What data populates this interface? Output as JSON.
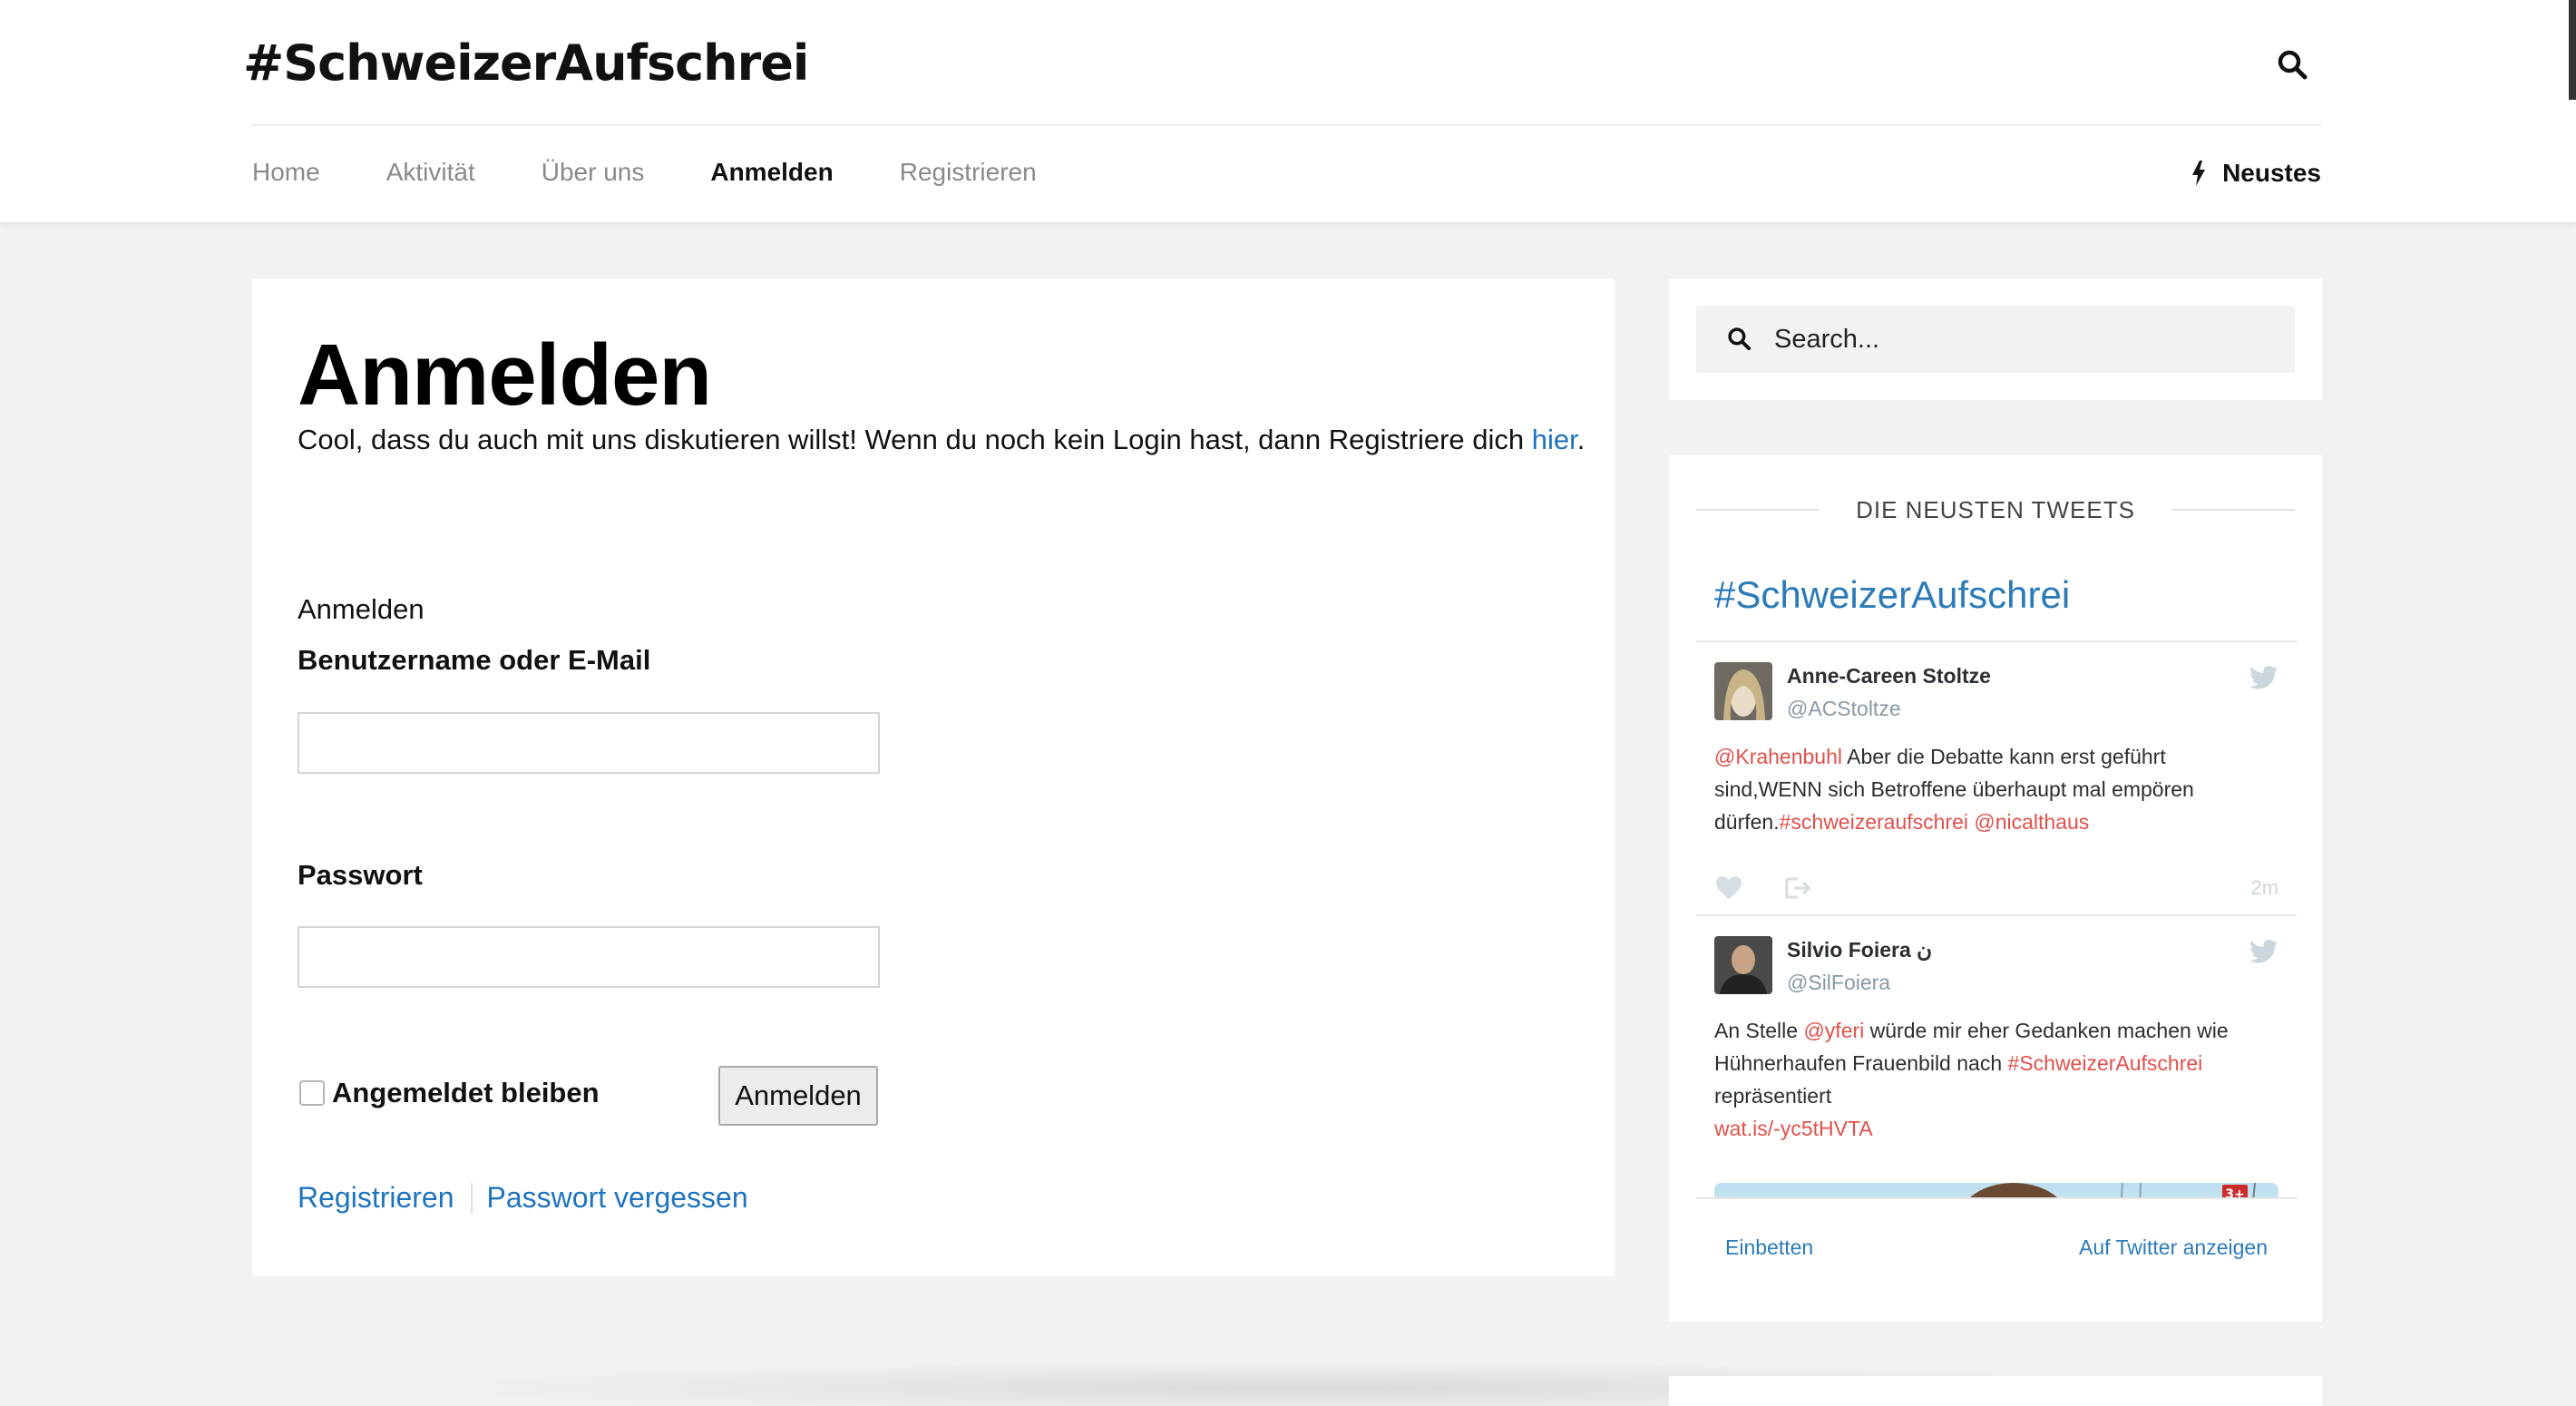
{
  "header": {
    "site_title": "#SchweizerAufschrei",
    "nav": [
      "Home",
      "Aktivität",
      "Über uns",
      "Anmelden",
      "Registrieren"
    ],
    "active_nav": "Anmelden",
    "neustes_label": "Neustes"
  },
  "main": {
    "title": "Anmelden",
    "intro_text": "Cool, dass du auch mit uns diskutieren willst! Wenn du noch kein Login hast, dann Registriere dich ",
    "intro_link": "hier",
    "intro_end": ".",
    "form_legend": "Anmelden",
    "username_label": "Benutzername oder E-Mail",
    "username_value": "",
    "password_label": "Passwort",
    "password_value": "",
    "remember_label": "Angemeldet bleiben",
    "remember_checked": false,
    "submit_label": "Anmelden",
    "register_link": "Registrieren",
    "forgot_link": "Passwort vergessen"
  },
  "sidebar": {
    "search_placeholder": "Search...",
    "widget_title": "DIE NEUSTEN TWEETS",
    "embed_title": "#SchweizerAufschrei",
    "tweets": [
      {
        "name": "Anne-Careen Stoltze",
        "handle": "@ACStoltze",
        "mention": "@Krahenbuhl",
        "text_1": " Aber die Debatte kann erst geführt sind,WENN sich Betroffene überhaupt mal empören dürfen.",
        "hashtag": "#schweizeraufschrei",
        "space": " ",
        "mention_2": "@nicalthaus",
        "time": "2m"
      },
      {
        "name": "Silvio Foiera ن",
        "handle": "@SilFoiera",
        "text_1": "An Stelle ",
        "mention": "@yferi",
        "text_2": " würde mir eher Gedanken machen wie Hühnerhaufen Frauenbild nach ",
        "hashtag": "#SchweizerAufschrei",
        "text_3": " repräsentiert",
        "link": "wat.is/-yc5tHVTA",
        "badge": "3+"
      }
    ],
    "embed_link": "Einbetten",
    "view_link": "Auf Twitter anzeigen"
  },
  "colors": {
    "link_blue": "#1e73be",
    "twitter_blue": "#2b7bb9",
    "tweet_highlight": "#e0504a",
    "page_bg": "#f2f2f2"
  }
}
